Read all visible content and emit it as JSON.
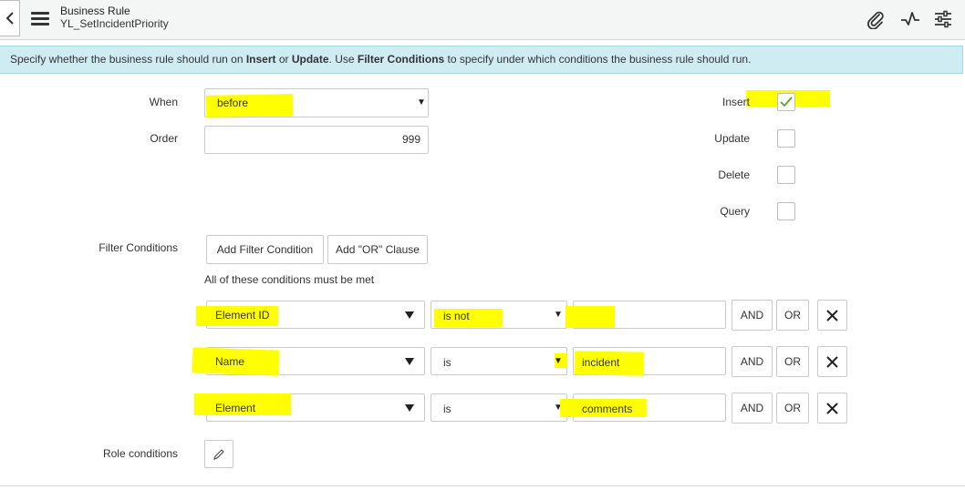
{
  "header": {
    "record_type": "Business Rule",
    "record_name": "YL_SetIncidentPriority"
  },
  "info": {
    "p1": "Specify whether the business rule should run on ",
    "b1": "Insert",
    "p2": " or ",
    "b2": "Update",
    "p3": ". Use ",
    "b3": "Filter Conditions",
    "p4": " to specify under which conditions the business rule should run."
  },
  "form": {
    "when_label": "When",
    "when_value": "before",
    "order_label": "Order",
    "order_value": "999",
    "insert_label": "Insert",
    "insert_checked": true,
    "update_label": "Update",
    "update_checked": false,
    "delete_label": "Delete",
    "delete_checked": false,
    "query_label": "Query",
    "query_checked": false,
    "filter_label": "Filter Conditions",
    "add_filter_button": "Add Filter Condition",
    "add_or_button": "Add \"OR\" Clause",
    "conditions_note": "All of these conditions must be met",
    "conditions": [
      {
        "field": "Element ID",
        "operator": "is not",
        "value": "",
        "and": "AND",
        "or": "OR"
      },
      {
        "field": "Name",
        "operator": "is",
        "value": "incident",
        "and": "AND",
        "or": "OR"
      },
      {
        "field": "Element",
        "operator": "is",
        "value": "comments",
        "and": "AND",
        "or": "OR"
      }
    ],
    "role_label": "Role conditions"
  },
  "colors": {
    "highlight": "#ffff00",
    "info_bg": "#d0ecf3",
    "check": "#5aa02c"
  }
}
